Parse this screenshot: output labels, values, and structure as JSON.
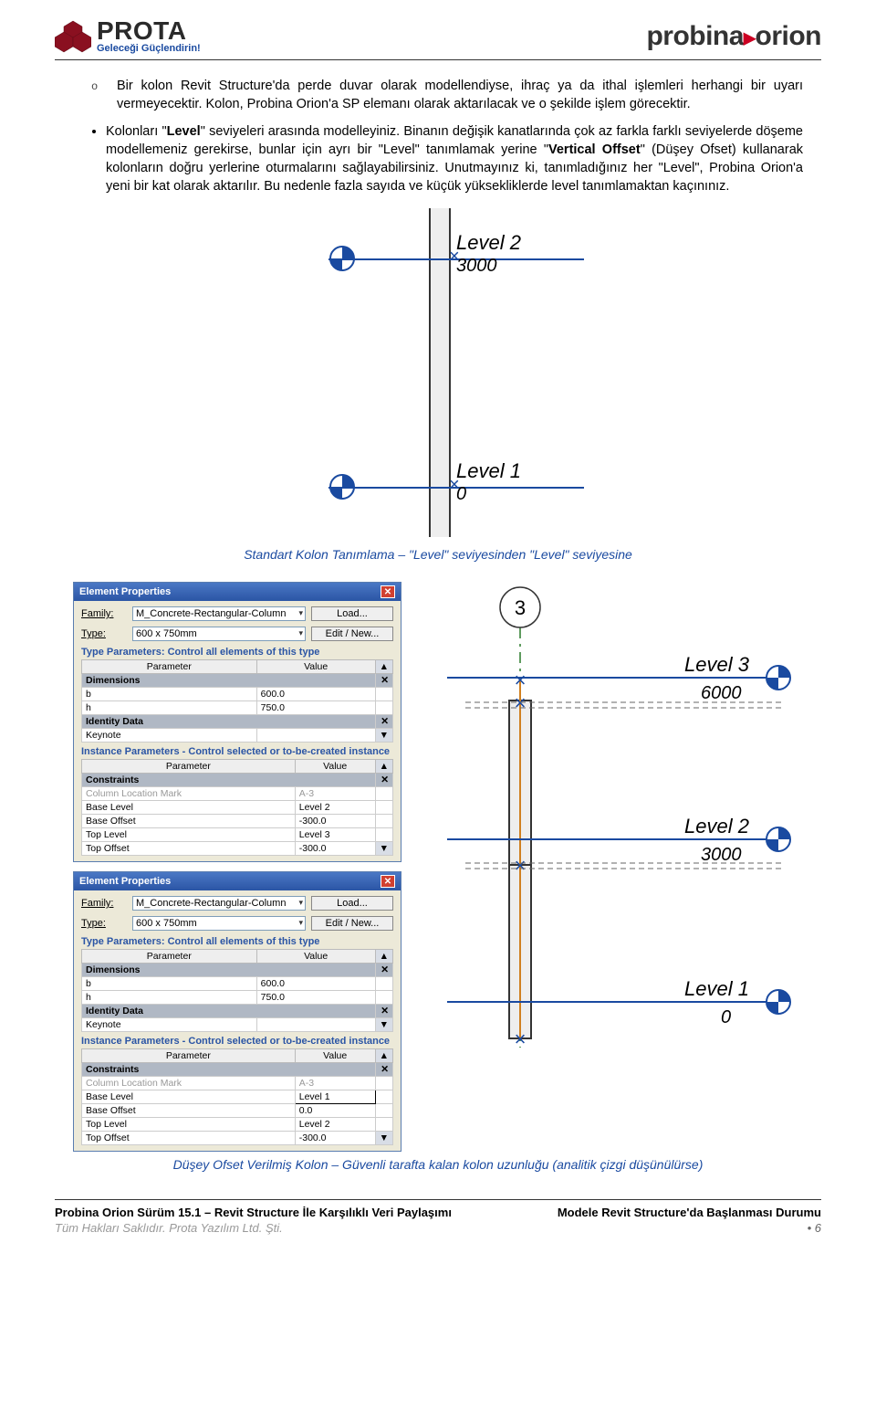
{
  "header": {
    "prota_name": "PROTA",
    "prota_tagline": "Geleceği Güçlendirin!",
    "probina_text_a": "probina",
    "probina_text_b": "orion"
  },
  "body": {
    "para1": "Bir kolon Revit Structure'da perde duvar olarak modellendiyse, ihraç ya da ithal işlemleri herhangi bir uyarı vermeyecektir. Kolon, Probina Orion'a SP elemanı olarak aktarılacak ve o şekilde işlem görecektir.",
    "para2_a": "Kolonları \"",
    "para2_b": "Level",
    "para2_c": "\" seviyeleri arasında modelleyiniz. Binanın değişik kanatlarında çok az farkla farklı seviyelerde döşeme modellemeniz gerekirse, bunlar için ayrı bir \"Level\" tanımlamak yerine \"",
    "para2_d": "Vertical Offset",
    "para2_e": "\" (Düşey Ofset) kullanarak kolonların doğru yerlerine oturmalarını sağlayabilirsiniz. Unutmayınız ki, tanımladığınız her \"Level\", Probina Orion'a yeni bir kat olarak aktarılır. Bu nedenle fazla sayıda ve küçük yüksekliklerde level tanımlamaktan kaçınınız."
  },
  "fig1": {
    "level2_label": "Level 2",
    "level2_val": "3000",
    "level1_label": "Level 1",
    "level1_val": "0",
    "caption": "Standart Kolon Tanımlama – \"Level\" seviyesinden \"Level\" seviyesine"
  },
  "panel": {
    "title": "Element Properties",
    "family_lbl": "Family:",
    "family_val": "M_Concrete-Rectangular-Column",
    "type_lbl": "Type:",
    "type_val": "600 x 750mm",
    "load_btn": "Load...",
    "edit_btn": "Edit / New...",
    "type_params_lbl": "Type Parameters: Control all elements of this type",
    "param_col": "Parameter",
    "value_col": "Value",
    "dimensions": "Dimensions",
    "b_name": "b",
    "b_val": "600.0",
    "h_name": "h",
    "h_val": "750.0",
    "identity": "Identity Data",
    "keynote": "Keynote",
    "inst_lbl": "Instance Parameters - Control selected or to-be-created instance",
    "constraints": "Constraints",
    "clm_name": "Column Location Mark",
    "clm_val": "A-3",
    "bl_name": "Base Level",
    "bo_name": "Base Offset",
    "tl_name": "Top Level",
    "to_name": "Top Offset",
    "p1_bl": "Level 2",
    "p1_bo": "-300.0",
    "p1_tl": "Level 3",
    "p1_to": "-300.0",
    "p2_bl": "Level 1",
    "p2_bo": "0.0",
    "p2_tl": "Level 2",
    "p2_to": "-300.0"
  },
  "fig2": {
    "grid_bubble": "3",
    "level3_label": "Level 3",
    "level3_val": "6000",
    "level2_label": "Level 2",
    "level2_val": "3000",
    "level1_label": "Level 1",
    "level1_val": "0",
    "caption": "Düşey Ofset Verilmiş Kolon – Güvenli tarafta kalan kolon uzunluğu (analitik çizgi düşünülürse)"
  },
  "footer": {
    "left1": "Probina Orion Sürüm 15.1 – Revit Structure İle Karşılıklı Veri Paylaşımı",
    "right1": "Modele Revit Structure'da Başlanması Durumu",
    "left2": "Tüm Hakları Saklıdır. Prota Yazılım Ltd. Şti.",
    "bullet": "•",
    "page": "6"
  }
}
